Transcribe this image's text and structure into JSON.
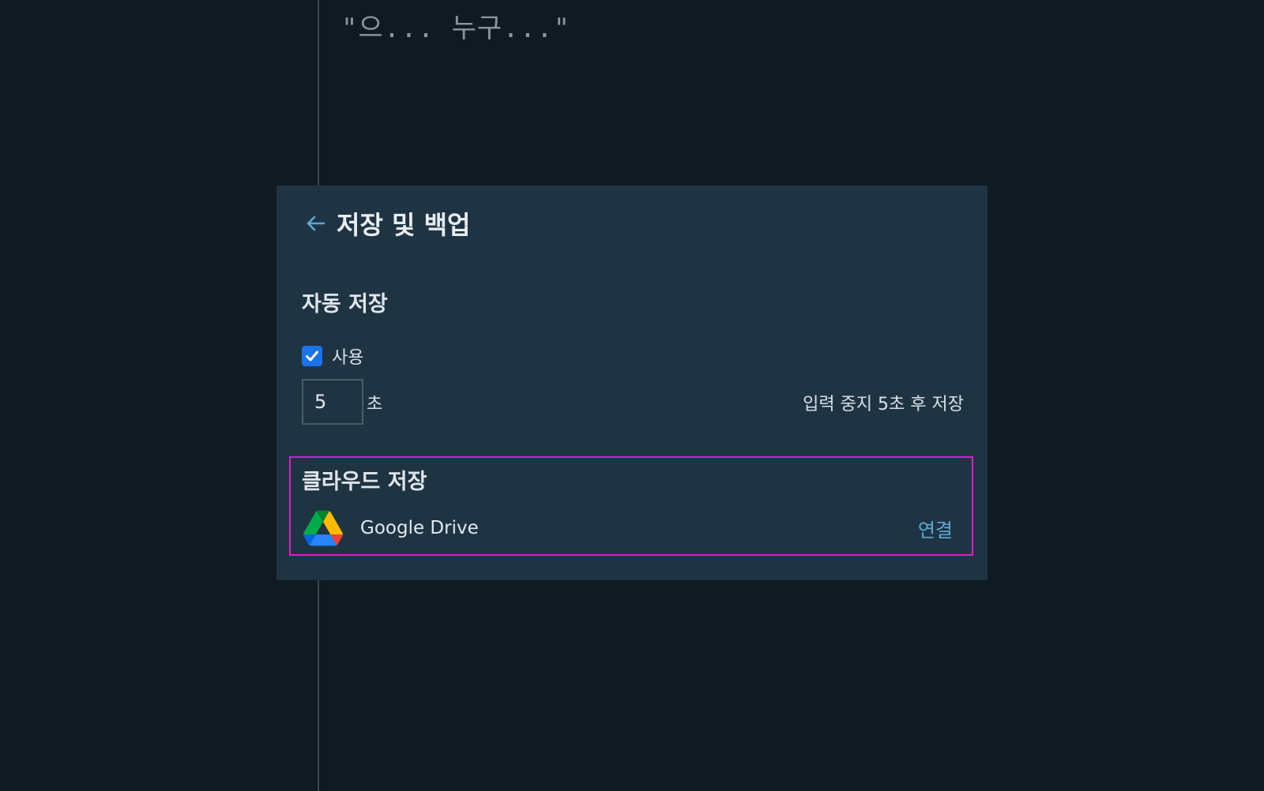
{
  "editor": {
    "text": "\"으... 누구...\""
  },
  "panel": {
    "title": "저장 및 백업",
    "back_icon": "arrow-left-icon"
  },
  "autosave": {
    "heading": "자동 저장",
    "enable_label": "사용",
    "enabled": true,
    "seconds_value": "5",
    "seconds_unit": "초",
    "hint": "입력 중지 5초 후 저장"
  },
  "cloud": {
    "heading": "클라우드 저장",
    "provider_icon": "google-drive-icon",
    "provider_name": "Google Drive",
    "connect_label": "연결"
  },
  "colors": {
    "background": "#101a22",
    "panel": "#1f3443",
    "accent": "#5fa9d6",
    "checkbox": "#1a73e8",
    "highlight": "#d81fc6"
  }
}
